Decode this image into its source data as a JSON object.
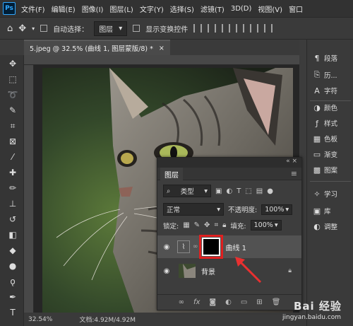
{
  "app": {
    "logo": "Ps"
  },
  "menu": [
    "文件(F)",
    "编辑(E)",
    "图像(I)",
    "图层(L)",
    "文字(Y)",
    "选择(S)",
    "滤镜(T)",
    "3D(D)",
    "视图(V)",
    "窗口"
  ],
  "options_bar": {
    "auto_select_label": "自动选择：",
    "auto_select_target": "图层",
    "show_transform_label": "显示变换控件"
  },
  "document": {
    "tab_title": "5.jpeg @ 32.5% (曲线 1, 图层蒙版/8) *",
    "zoom": "32.54%",
    "doc_size": "文档:4.92M/4.92M"
  },
  "right_panel": {
    "items": [
      "段落",
      "历...",
      "字符",
      "颜色",
      "样式",
      "色板",
      "渐变",
      "图案",
      "学习",
      "库",
      "调整"
    ]
  },
  "layers_panel": {
    "tab": "图层",
    "filter_label": "类型",
    "blend_mode": "正常",
    "opacity_label": "不透明度:",
    "opacity_value": "100%",
    "lock_label": "锁定:",
    "fill_label": "填充:",
    "fill_value": "100%",
    "layers": [
      {
        "name": "曲线 1",
        "selected": true
      },
      {
        "name": "背景",
        "selected": false
      }
    ]
  },
  "watermark": {
    "text": "Bai 经验",
    "url": "jingyan.baidu.com"
  },
  "colors": {
    "highlight_box": "#e02020",
    "arrow": "#e83030",
    "mask_fill": "#000000"
  }
}
